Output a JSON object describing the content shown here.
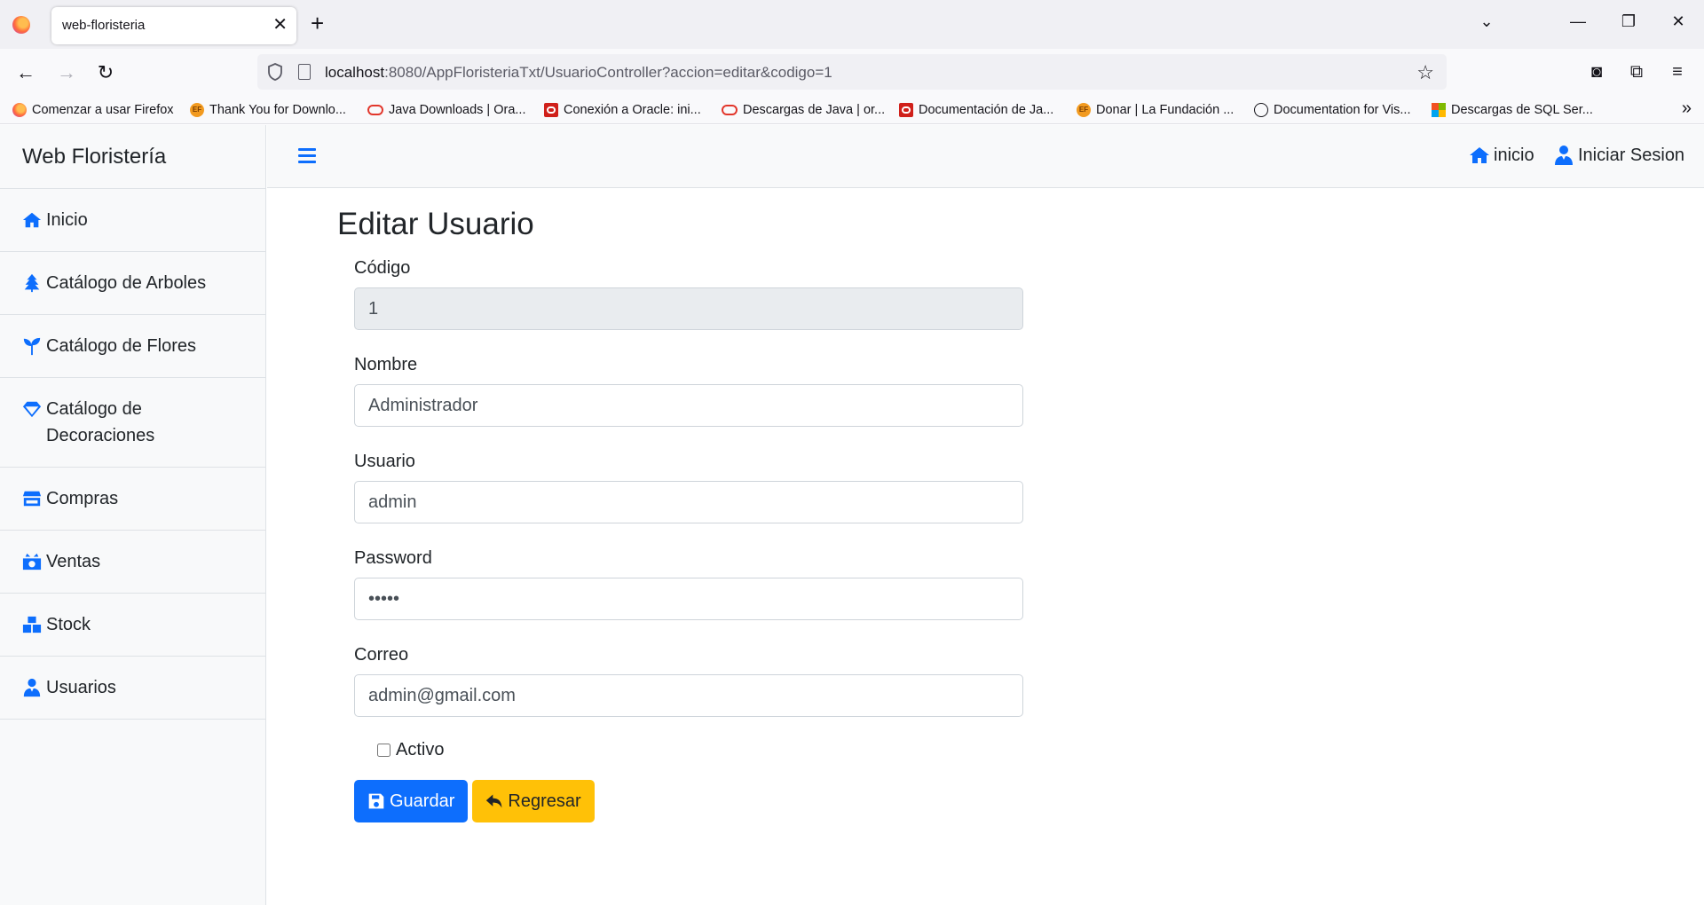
{
  "browser": {
    "tab_title": "web-floristeria",
    "url_host": "localhost",
    "url_rest": ":8080/AppFloristeriaTxt/UsuarioController?accion=editar&codigo=1",
    "bookmarks": [
      {
        "label": "Comenzar a usar Firefox",
        "icon": "firefox-icon"
      },
      {
        "label": "Thank You for Downlo...",
        "icon": "ef-icon"
      },
      {
        "label": "Java Downloads | Ora...",
        "icon": "oracle-icon"
      },
      {
        "label": "Conexión a Oracle: ini...",
        "icon": "oracle-square-icon"
      },
      {
        "label": "Descargas de Java | or...",
        "icon": "oracle-icon"
      },
      {
        "label": "Documentación de Ja...",
        "icon": "oracle-square-icon"
      },
      {
        "label": "Donar | La Fundación ...",
        "icon": "ef-icon"
      },
      {
        "label": "Documentation for Vis...",
        "icon": "globe-icon"
      },
      {
        "label": "Descargas de SQL Ser...",
        "icon": "microsoft-icon"
      }
    ]
  },
  "app": {
    "brand": "Web Floristería",
    "sidebar": [
      {
        "label": "Inicio",
        "icon": "home-icon"
      },
      {
        "label": "Catálogo de Arboles",
        "icon": "tree-icon"
      },
      {
        "label": "Catálogo de Flores",
        "icon": "seedling-icon"
      },
      {
        "label": "Catálogo de Decoraciones",
        "icon": "gem-icon"
      },
      {
        "label": "Compras",
        "icon": "store-icon"
      },
      {
        "label": "Ventas",
        "icon": "cash-icon"
      },
      {
        "label": "Stock",
        "icon": "boxes-icon"
      },
      {
        "label": "Usuarios",
        "icon": "user-tie-icon"
      }
    ],
    "topnav": {
      "home_label": "inicio",
      "login_label": "Iniciar Sesion"
    }
  },
  "form": {
    "title": "Editar Usuario",
    "codigo_label": "Código",
    "codigo_value": "1",
    "nombre_label": "Nombre",
    "nombre_value": "Administrador",
    "usuario_label": "Usuario",
    "usuario_value": "admin",
    "password_label": "Password",
    "password_value": "admin",
    "correo_label": "Correo",
    "correo_value": "admin@gmail.com",
    "activo_label": "Activo",
    "activo_checked": false,
    "save_label": "Guardar",
    "back_label": "Regresar"
  },
  "colors": {
    "primary": "#0d6efd",
    "warning": "#ffc107",
    "sidebar_bg": "#f8f9fa"
  }
}
